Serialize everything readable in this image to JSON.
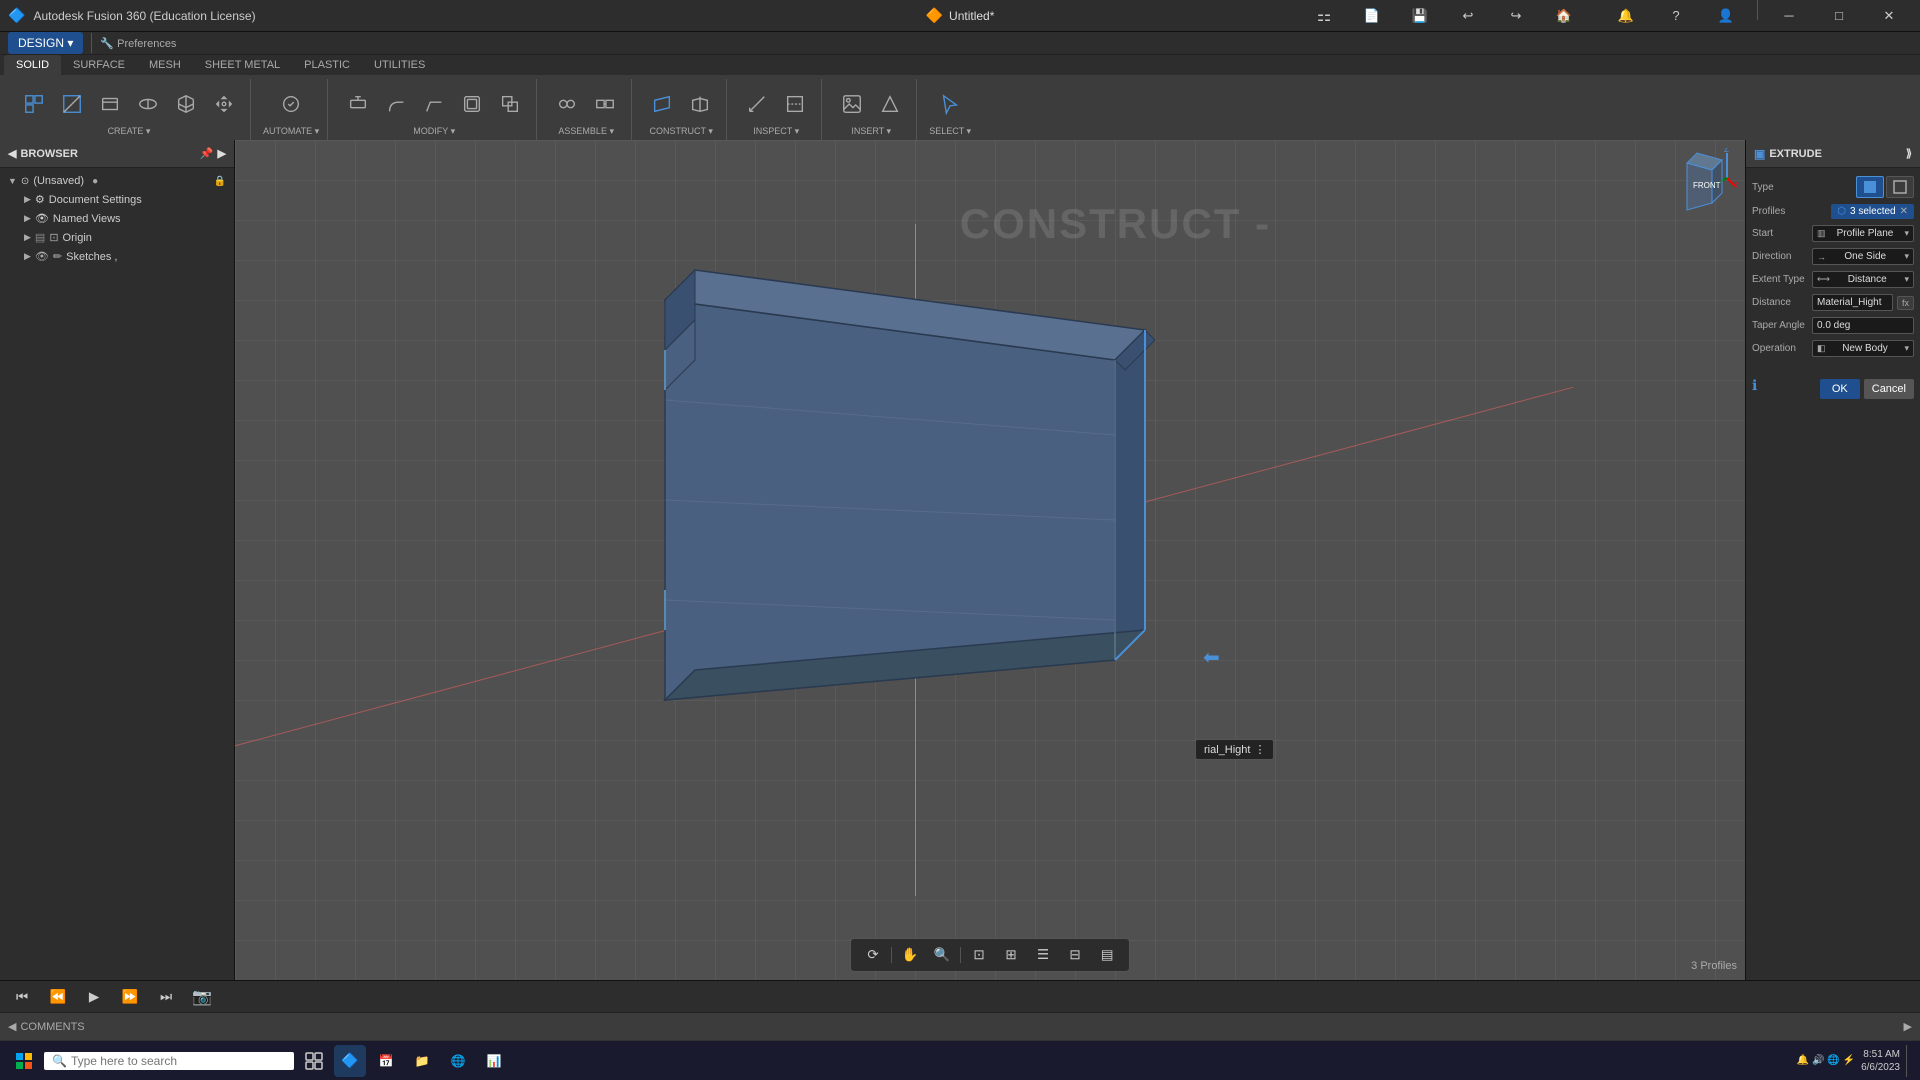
{
  "app": {
    "title": "Autodesk Fusion 360 (Education License)",
    "file_title": "Untitled*"
  },
  "titlebar": {
    "title": "Autodesk Fusion 360 (Education License)",
    "minimize": "─",
    "maximize": "□",
    "close": "✕"
  },
  "ribbon": {
    "tabs": [
      {
        "label": "SOLID",
        "active": true
      },
      {
        "label": "SURFACE",
        "active": false
      },
      {
        "label": "MESH",
        "active": false
      },
      {
        "label": "SHEET METAL",
        "active": false
      },
      {
        "label": "PLASTIC",
        "active": false
      },
      {
        "label": "UTILITIES",
        "active": false
      }
    ],
    "design_btn": "DESIGN ▾",
    "groups": [
      {
        "label": "CREATE ▾"
      },
      {
        "label": "AUTOMATE ▾"
      },
      {
        "label": "MODIFY ▾"
      },
      {
        "label": "ASSEMBLE ▾"
      },
      {
        "label": "CONSTRUCT ▾"
      },
      {
        "label": "INSPECT ▾"
      },
      {
        "label": "INSERT ▾"
      },
      {
        "label": "SELECT ▾"
      }
    ]
  },
  "browser": {
    "title": "BROWSER",
    "items": [
      {
        "label": "(Unsaved)",
        "depth": 0,
        "icon": "📄"
      },
      {
        "label": "Document Settings",
        "depth": 1,
        "icon": "⚙"
      },
      {
        "label": "Named Views",
        "depth": 1,
        "icon": "👁"
      },
      {
        "label": "Origin",
        "depth": 1,
        "icon": "📦"
      },
      {
        "label": "Sketches ,",
        "depth": 1,
        "icon": "✏"
      }
    ]
  },
  "extrude": {
    "title": "EXTRUDE",
    "type_label": "Type",
    "profiles_label": "Profiles",
    "profiles_value": "3 selected",
    "start_label": "Start",
    "start_value": "Profile Plane",
    "direction_label": "Direction",
    "direction_value": "One Side",
    "extent_type_label": "Extent Type",
    "extent_type_value": "Distance",
    "distance_label": "Distance",
    "distance_value": "Material_Hight",
    "taper_angle_label": "Taper Angle",
    "taper_angle_value": "0.0 deg",
    "operation_label": "Operation",
    "operation_value": "New Body",
    "ok_btn": "OK",
    "cancel_btn": "Cancel"
  },
  "viewport": {
    "tooltip_value": "rial_Hight",
    "profiles_count": "3 Profiles",
    "construct_label": "CONSTRUCT -"
  },
  "comments": {
    "title": "COMMENTS"
  },
  "status_bar": {
    "time": "8:51 AM",
    "date": "6/6/2023"
  },
  "taskbar": {
    "search_placeholder": "Type here to search"
  }
}
